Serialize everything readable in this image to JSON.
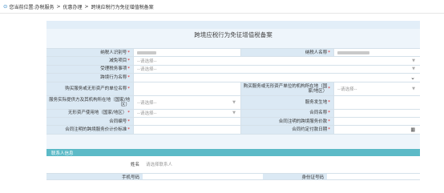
{
  "breadcrumb": {
    "prefix": "您当前位置:",
    "items": [
      "办税服务",
      "优惠办理",
      "跨境应税行为免征增值税备案"
    ],
    "separator": ">"
  },
  "page_title": "跨境应税行为免征增值税备案",
  "form": {
    "taxpayer_id_label": "纳税人识别号",
    "taxpayer_name_label": "纳税人名称",
    "exemption_item_label": "减免项目",
    "acceptance_tax_office_label": "受理税务事项",
    "cross_border_act_label": "跨境行为名称",
    "buyer_name_label": "购买服务或无形资产的单位名称",
    "buyer_country_label": "购买服务或无形资产单位的机构所在地（国家/地区）",
    "service_place_label": "服务实际提供方及其机构所在地（国家/地区）",
    "service_occur_label": "服务发生地",
    "intangible_use_label": "无形资产使用地（国家/地区）",
    "contract_name_label": "合同名称",
    "contract_no_label": "合同编号",
    "contract_amount_label": "合同注明的跨境服务价款",
    "contract_price_label": "合同注明的跨境服务价计价标准",
    "contract_date_label": "合同约定付款日期",
    "select_placeholder": "--请选择--",
    "required_mark": "*"
  },
  "contact": {
    "section_title": "联系人信息",
    "name_label": "姓名",
    "name_placeholder": "请选择联系人",
    "phone_label": "手机号码",
    "id_label": "身份证号码"
  },
  "icons": {
    "location": "location-pin-icon",
    "dropdown": "chevron-down-icon",
    "calendar": "calendar-icon"
  },
  "colors": {
    "accent": "#2d84c6",
    "label_bg": "#dbe9f4",
    "section_bar": "#5cbac7",
    "required": "#e02020"
  }
}
